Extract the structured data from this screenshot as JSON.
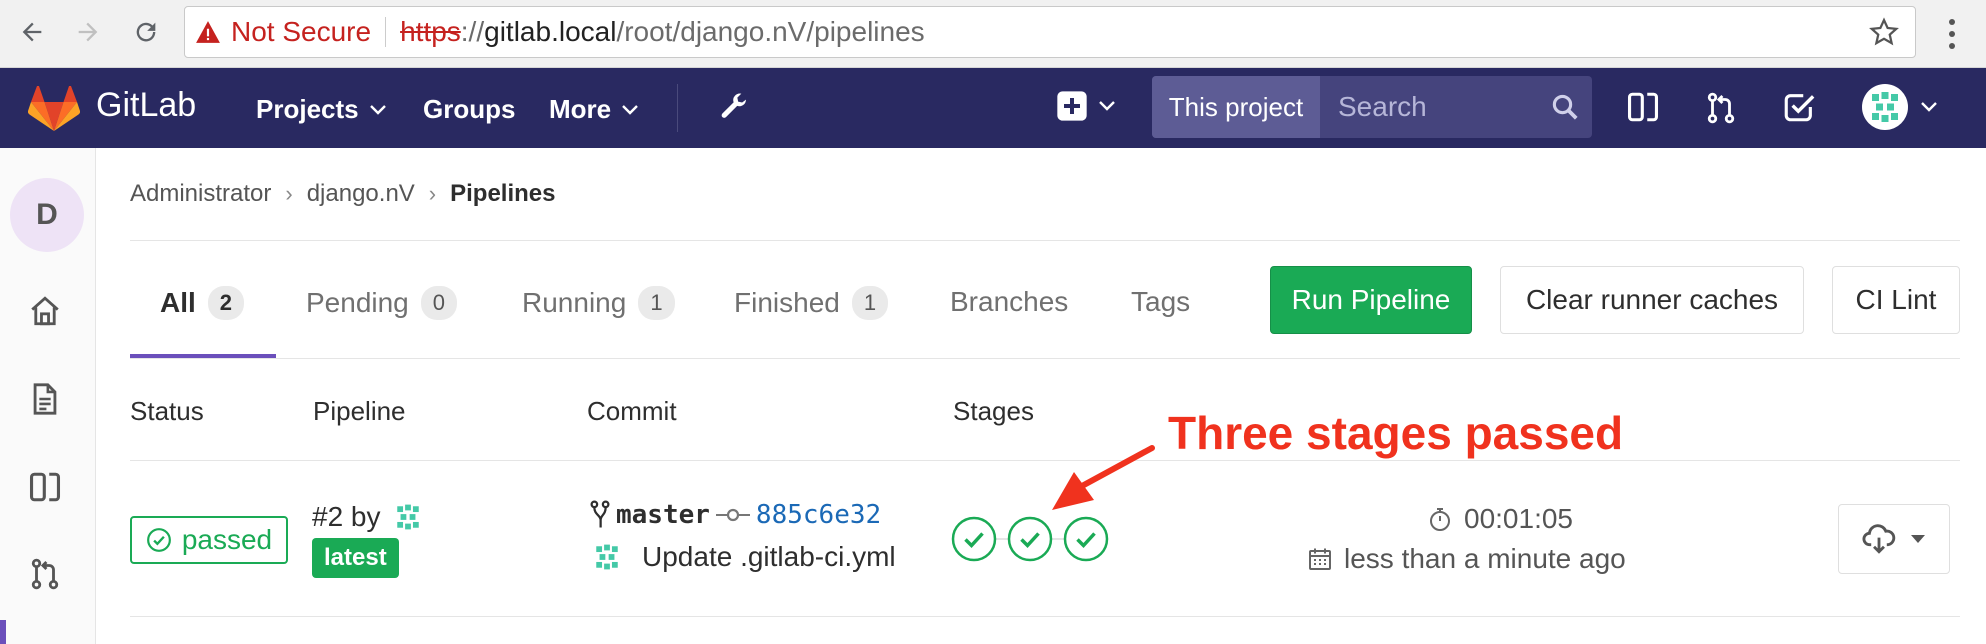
{
  "browser": {
    "security_label": "Not Secure",
    "url_scheme": "https",
    "url_rest": "://",
    "url_host": "gitlab.local",
    "url_path": "/root/django.nV/pipelines"
  },
  "header": {
    "brand": "GitLab",
    "nav": [
      {
        "label": "Projects"
      },
      {
        "label": "Groups"
      },
      {
        "label": "More"
      }
    ],
    "search_scope": "This project",
    "search_placeholder": "Search"
  },
  "sidebar": {
    "project_initial": "D"
  },
  "breadcrumb": {
    "items": [
      "Administrator",
      "django.nV",
      "Pipelines"
    ]
  },
  "tabs": [
    {
      "label": "All",
      "count": "2"
    },
    {
      "label": "Pending",
      "count": "0"
    },
    {
      "label": "Running",
      "count": "1"
    },
    {
      "label": "Finished",
      "count": "1"
    },
    {
      "label": "Branches"
    },
    {
      "label": "Tags"
    }
  ],
  "actions": {
    "run_pipeline": "Run Pipeline",
    "clear_caches": "Clear runner caches",
    "ci_lint": "CI Lint"
  },
  "table": {
    "headers": [
      "Status",
      "Pipeline",
      "Commit",
      "Stages"
    ],
    "row": {
      "status": "passed",
      "pipeline_id": "#2 by",
      "tag": "latest",
      "branch": "master",
      "sha": "885c6e32",
      "message": "Update .gitlab-ci.yml",
      "stages": [
        "passed",
        "passed",
        "passed"
      ],
      "duration": "00:01:05",
      "finished": "less than a minute ago"
    }
  },
  "annotation": "Three stages passed",
  "colors": {
    "header_bg": "#292961",
    "success": "#1aaa55",
    "annotation": "#f0321e",
    "active_tab": "#6b4fbb"
  }
}
